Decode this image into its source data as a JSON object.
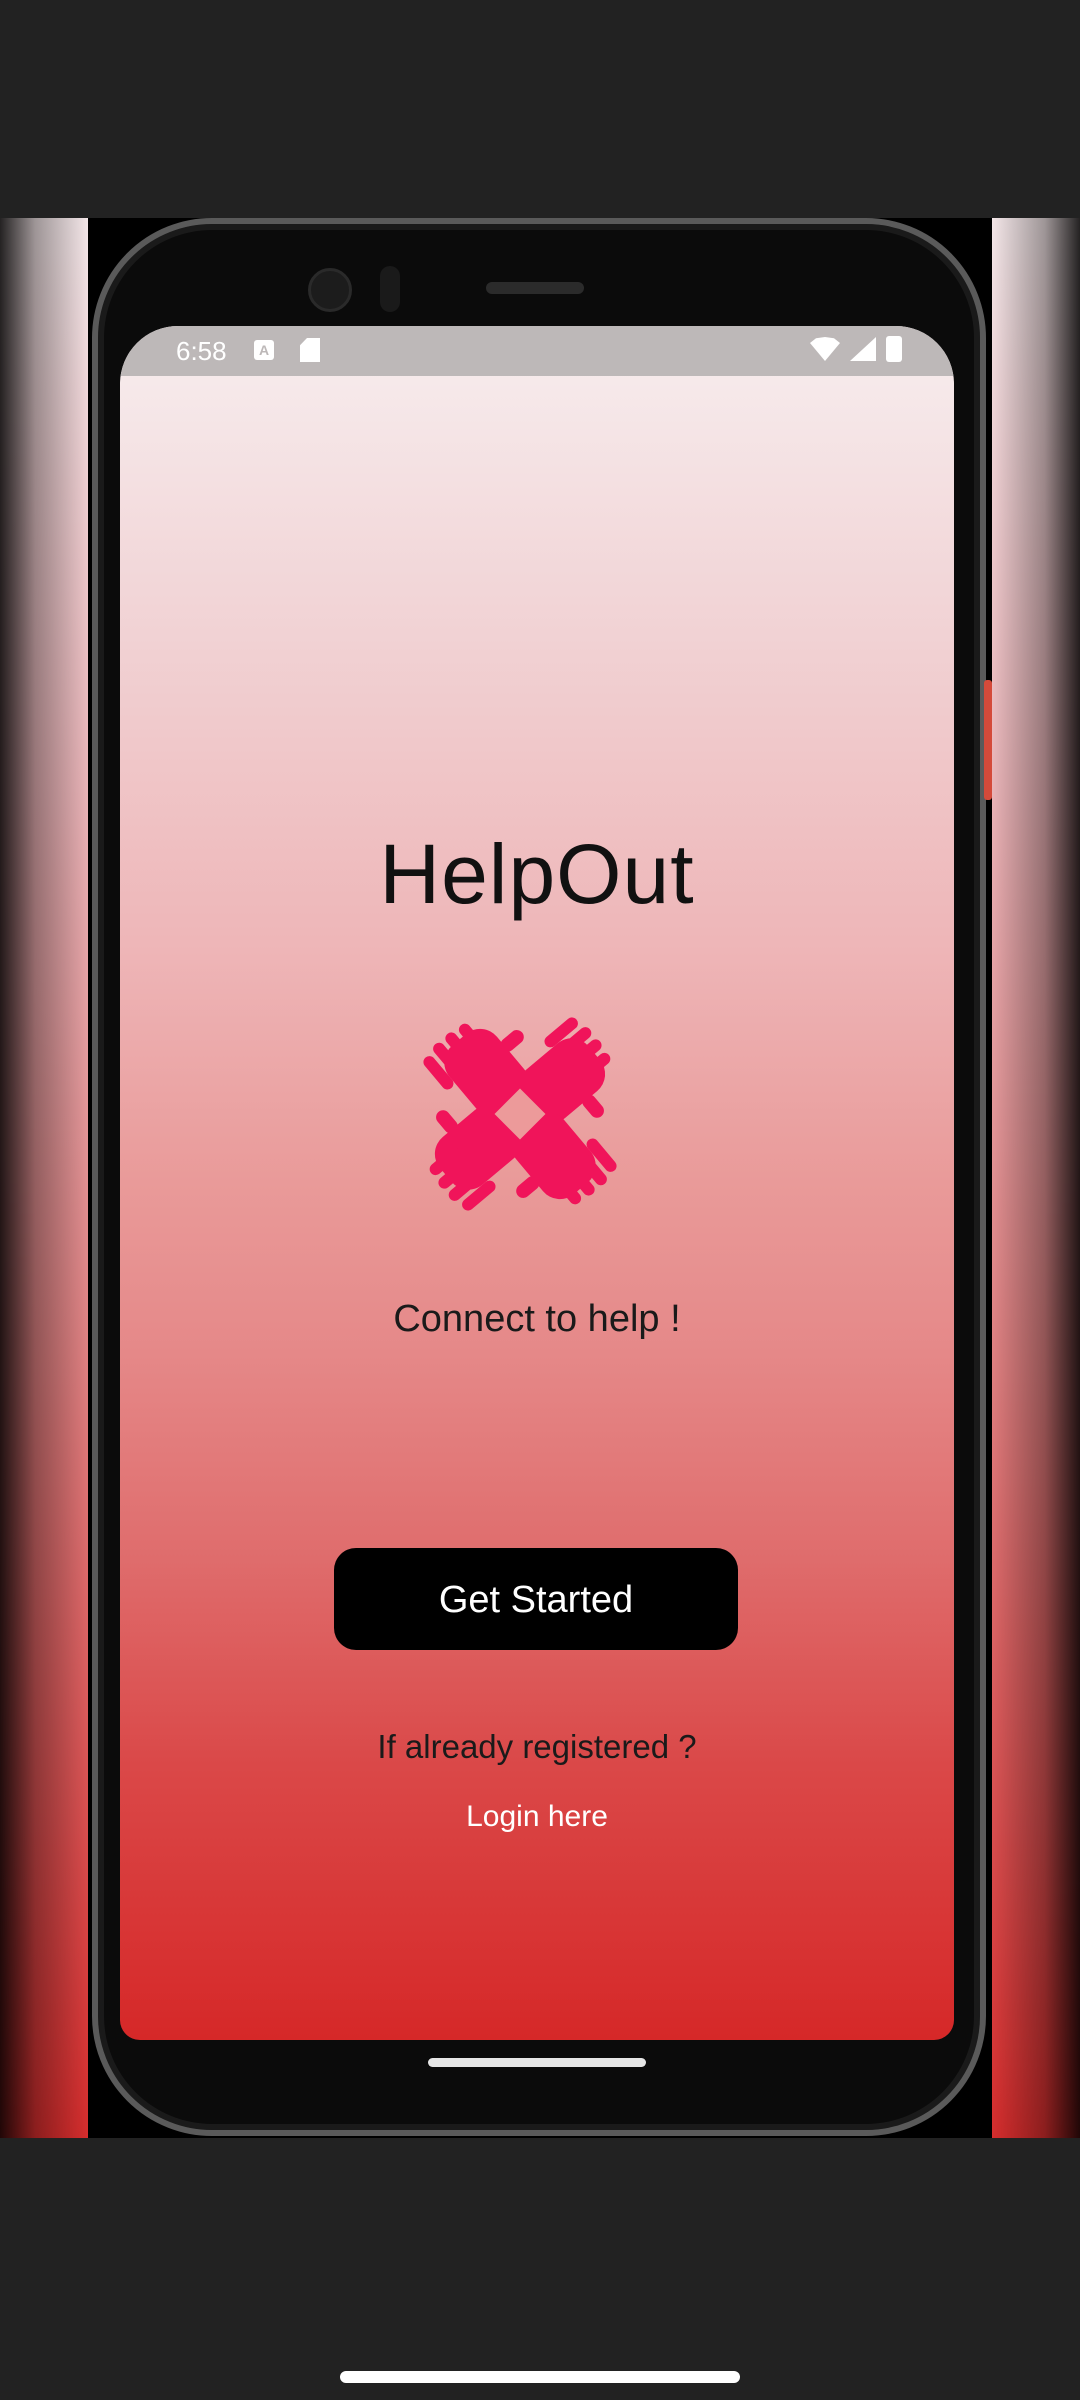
{
  "status_bar": {
    "time": "6:58",
    "icon_a": "A"
  },
  "app": {
    "title": "HelpOut",
    "tagline": "Connect to help !",
    "primary_button": "Get Started",
    "registered_prompt": "If already registered ?",
    "login_link": "Login here"
  },
  "icons": {
    "logo": "four-hands-icon",
    "status": [
      "a-icon",
      "sd-card-icon",
      "wifi-icon",
      "signal-icon",
      "battery-icon"
    ]
  },
  "colors": {
    "logo": "#f0145a",
    "button": "#000000",
    "gradient_top": "#f7eeef",
    "gradient_bottom": "#d62828",
    "status_bar": "#bdb8b8"
  }
}
